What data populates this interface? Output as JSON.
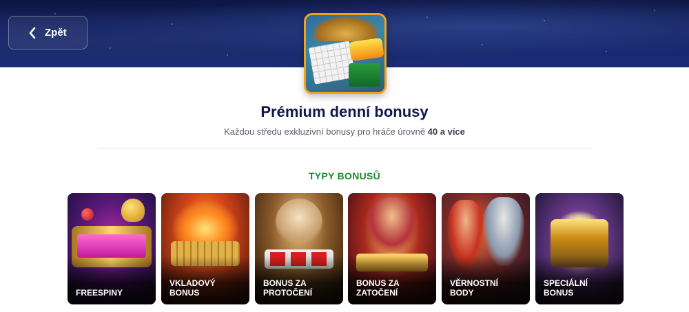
{
  "header": {
    "back_label": "Zpět",
    "back_icon": "chevron-left-icon"
  },
  "promo": {
    "image_name": "promo-thumbnail-image",
    "title": "Prémium denní bonusy",
    "subtitle_text": "Každou středu exkluzivní bonusy pro hráče úrovně ",
    "subtitle_highlight": "40 a více"
  },
  "section": {
    "heading": "TYPY BONUSŮ"
  },
  "bonus_types": [
    {
      "label": "FREESPINY"
    },
    {
      "label": "VKLADOVÝ\nBONUS"
    },
    {
      "label": "BONUS ZA\nPROTOČENÍ"
    },
    {
      "label": "BONUS ZA\nZATOČENÍ"
    },
    {
      "label": "VĚRNOSTNÍ\nBODY"
    },
    {
      "label": "SPECIÁLNÍ\nBONUS"
    }
  ],
  "colors": {
    "title": "#10184a",
    "accent_green": "#1c8a2a",
    "hero_bg": "#16246a",
    "thumb_border": "#f4a11a"
  }
}
